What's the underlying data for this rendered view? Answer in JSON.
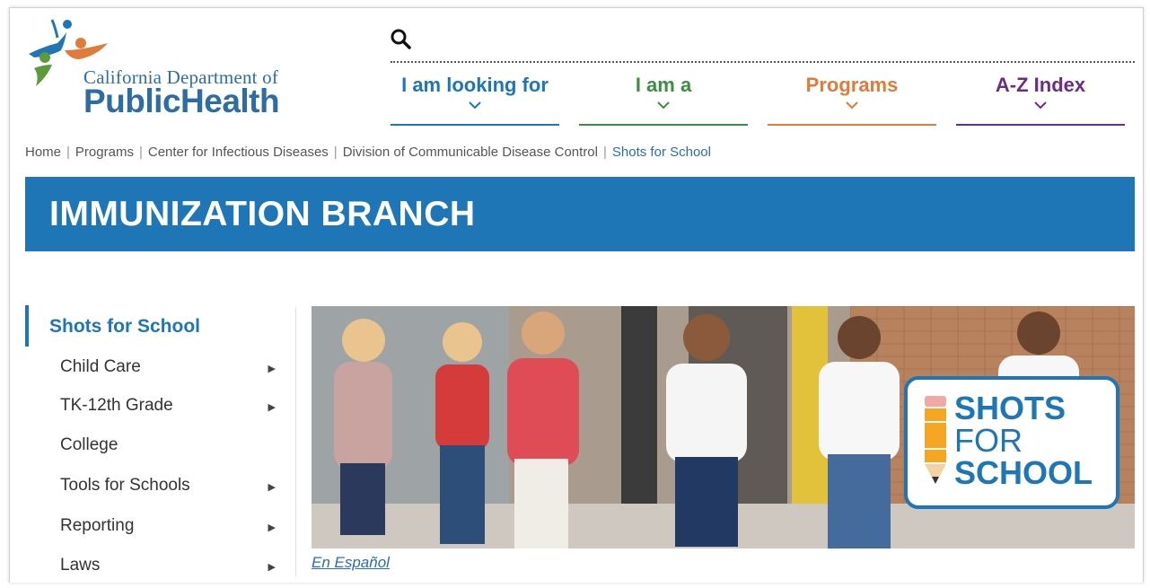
{
  "logo": {
    "org_line1": "California Department of",
    "org_line2": "PublicHealth"
  },
  "search": {
    "icon": "search-icon"
  },
  "nav": [
    {
      "label": "I am looking for",
      "color": "#1f76b6"
    },
    {
      "label": "I am a",
      "color": "#3e8e41"
    },
    {
      "label": "Programs",
      "color": "#e07b3a"
    },
    {
      "label": "A-Z Index",
      "color": "#6b2c84"
    }
  ],
  "breadcrumb": {
    "items": [
      "Home",
      "Programs",
      "Center for Infectious Diseases",
      "Division of Communicable Disease Control"
    ],
    "current": "Shots for School"
  },
  "banner": {
    "title": "IMMUNIZATION BRANCH",
    "color": "#1f76b6"
  },
  "sidebar": {
    "title": "Shots for School",
    "items": [
      {
        "label": "Child Care",
        "has_submenu": true
      },
      {
        "label": "TK-12th Grade",
        "has_submenu": true
      },
      {
        "label": "College",
        "has_submenu": false
      },
      {
        "label": "Tools for Schools",
        "has_submenu": true
      },
      {
        "label": "Reporting",
        "has_submenu": true
      },
      {
        "label": "Laws",
        "has_submenu": true
      }
    ]
  },
  "hero": {
    "badge_line1": "SHOTS",
    "badge_line2": "FOR",
    "badge_line3": "SCHOOL"
  },
  "links": {
    "en_espanol": "En Español"
  }
}
